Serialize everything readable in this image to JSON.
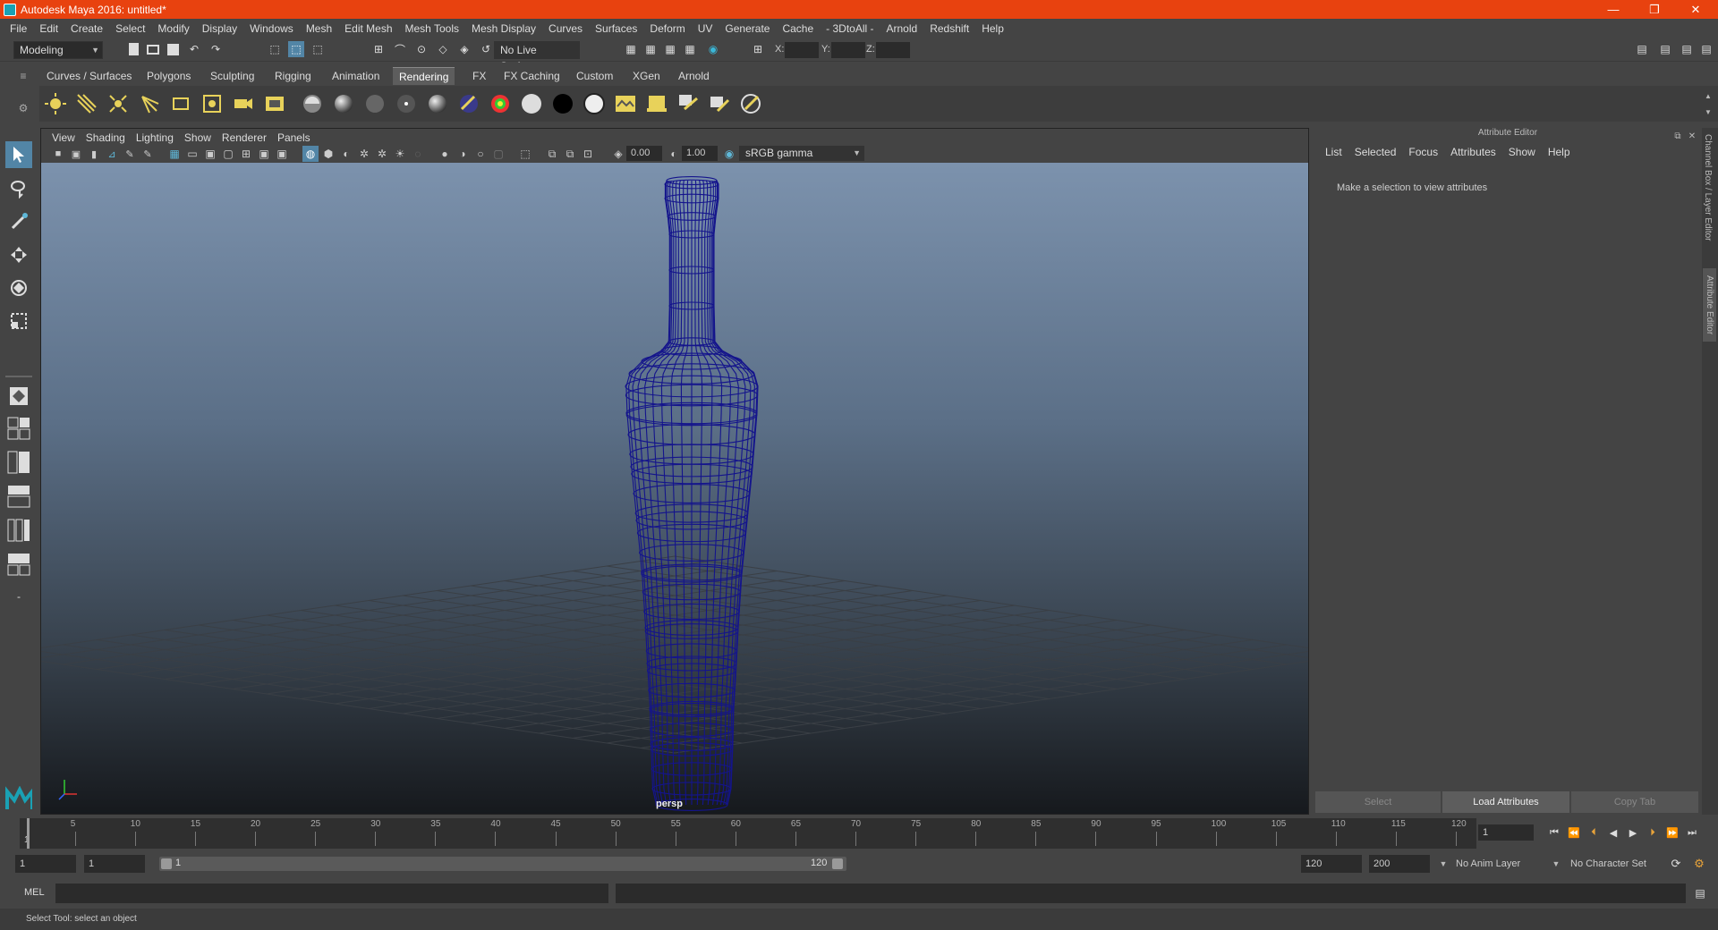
{
  "window": {
    "title": "Autodesk Maya 2016: untitled*",
    "minimize": "—",
    "restore": "❐",
    "close": "✕"
  },
  "menubar": [
    "File",
    "Edit",
    "Create",
    "Select",
    "Modify",
    "Display",
    "Windows",
    "Mesh",
    "Edit Mesh",
    "Mesh Tools",
    "Mesh Display",
    "Curves",
    "Surfaces",
    "Deform",
    "UV",
    "Generate",
    "Cache",
    "- 3DtoAll -",
    "Arnold",
    "Redshift",
    "Help"
  ],
  "statusline": {
    "mode": "Modeling",
    "live_surface": "No Live Surface",
    "x_label": "X:",
    "y_label": "Y:",
    "z_label": "Z:"
  },
  "shelf": {
    "tabs": [
      "Curves / Surfaces",
      "Polygons",
      "Sculpting",
      "Rigging",
      "Animation",
      "Rendering",
      "FX",
      "FX Caching",
      "Custom",
      "XGen",
      "Arnold"
    ],
    "active_tab": "Rendering"
  },
  "viewport": {
    "menus": [
      "View",
      "Shading",
      "Lighting",
      "Show",
      "Renderer",
      "Panels"
    ],
    "exposure": "0.00",
    "gamma": "1.00",
    "color_space": "sRGB gamma",
    "camera_label": "persp",
    "wire_color": "#14148c"
  },
  "attribute_editor": {
    "header": "Attribute Editor",
    "menus": [
      "List",
      "Selected",
      "Focus",
      "Attributes",
      "Show",
      "Help"
    ],
    "message": "Make a selection to view attributes",
    "buttons": {
      "select": "Select",
      "load": "Load Attributes",
      "copy": "Copy Tab"
    }
  },
  "side_tabs": {
    "channel_box": "Channel Box / Layer Editor",
    "attribute_editor": "Attribute Editor"
  },
  "timeline": {
    "ticks": [
      "5",
      "10",
      "15",
      "20",
      "25",
      "30",
      "35",
      "40",
      "45",
      "50",
      "55",
      "60",
      "65",
      "70",
      "75",
      "80",
      "85",
      "90",
      "95",
      "100",
      "105",
      "110",
      "115",
      "120"
    ],
    "start_marker": "1",
    "current_frame": "1"
  },
  "range": {
    "start": "1",
    "playback_start": "1",
    "slider_start": "1",
    "slider_end": "120",
    "playback_end": "120",
    "end": "200",
    "anim_layer": "No Anim Layer",
    "character_set": "No Character Set"
  },
  "mel": {
    "label": "MEL"
  },
  "help_line": "Select Tool: select an object",
  "colors": {
    "title_bar": "#e8420f",
    "accent": "#1aa1b4"
  }
}
